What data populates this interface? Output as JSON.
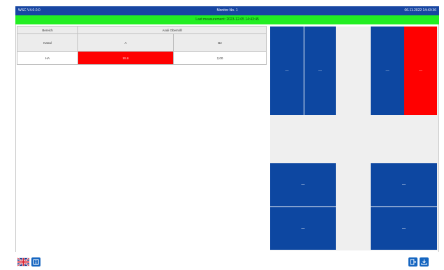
{
  "titlebar": {
    "left": "WSC V4.0.0.0",
    "center": "Monitor No. 1",
    "right": "06.11.2022 14:43:36"
  },
  "status": {
    "text": "Last measurement: 2023-12-05 14:43:45"
  },
  "table": {
    "row_label_header": "Bereich",
    "row_label_sub": "Kanal",
    "group_header": "Asuli Oberrolll",
    "col_a": "A",
    "col_b": "B2",
    "row_name": "HA",
    "value_a": "99.6",
    "value_b": "2,00"
  },
  "diagram": {
    "top_left_a": "—",
    "top_left_b": "—",
    "top_right_a": "—",
    "top_right_b": "—",
    "bottom_left_a": "—",
    "bottom_left_b": "—",
    "bottom_right_a": "—",
    "bottom_right_b": "—"
  },
  "colors": {
    "titlebar": "#1746a2",
    "statusbar": "#22ee22",
    "block": "#0d47a1",
    "alarm": "#ff0000"
  },
  "icons": {
    "language": "uk-flag-icon",
    "info": "info-icon",
    "exit": "door-exit-icon",
    "download": "download-icon"
  }
}
